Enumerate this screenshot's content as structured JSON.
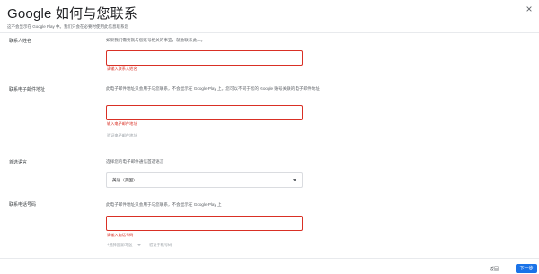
{
  "dialog": {
    "title": "Google 如何与您联系",
    "subtitle": "这不会显示在 Google Play 中。我们只会在必要时使用此信息联系您",
    "close_icon": "close-icon"
  },
  "fields": {
    "contact_name": {
      "label": "联系人姓名",
      "description": "如果我们需要就与您账号相关的事宜，就会联系此人。",
      "value": "",
      "error": "请输入联系人姓名"
    },
    "contact_email": {
      "label": "联系电子邮件地址",
      "description": "此电子邮件地址只会用于与您联系，不会显示在 Google Play 上。您可以不同于您的 Google 账号关联的电子邮件地址",
      "value": "",
      "error": "输入电子邮件地址",
      "helper": "验证电子邮件地址"
    },
    "language": {
      "label": "首选语言",
      "description": "选择您的电子邮件通信首选语言",
      "selected": "英语（美国）"
    },
    "phone": {
      "label": "联系电话号码",
      "description": "此电子邮件地址只会用于与您联系，不会显示在 Google Play 上",
      "value": "",
      "error": "请输入电话号码",
      "country_control": "+选择国家/地区",
      "verify_label": "验证手机号码"
    }
  },
  "footer": {
    "cancel_label": "返回",
    "next_label": "下一步"
  },
  "colors": {
    "error": "#d93025",
    "accent": "#1a73e8",
    "border": "#dadce0"
  }
}
